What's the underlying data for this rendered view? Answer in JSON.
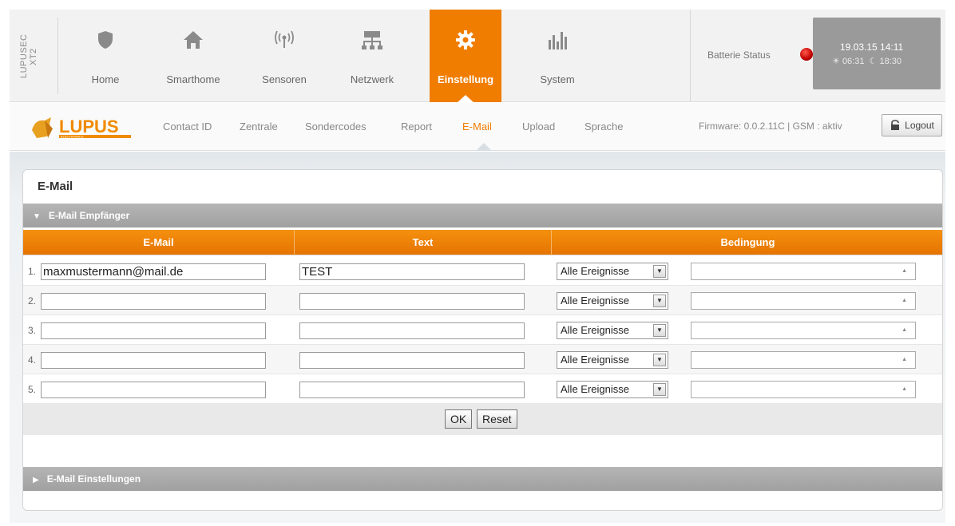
{
  "brand": {
    "line1": "LUPUSEC",
    "line2": "XT2"
  },
  "nav": [
    {
      "label": "Home",
      "icon": "shield-icon"
    },
    {
      "label": "Smarthome",
      "icon": "house-icon"
    },
    {
      "label": "Sensoren",
      "icon": "signal-icon"
    },
    {
      "label": "Netzwerk",
      "icon": "network-icon"
    },
    {
      "label": "Einstellung",
      "icon": "gear-icon",
      "active": true
    },
    {
      "label": "System",
      "icon": "bars-icon"
    }
  ],
  "status": {
    "battery_label": "Batterie Status",
    "battery_color": "#c00000",
    "datetime": "19.03.15 14:11",
    "sunrise": "06:31",
    "sunset": "18:30"
  },
  "subnav": {
    "logo_text": "LUPUS",
    "logo_sub": "ELECTRONICS",
    "items": [
      {
        "label": "Contact ID"
      },
      {
        "label": "Zentrale"
      },
      {
        "label": "Sondercodes"
      },
      {
        "label": "Report"
      },
      {
        "label": "E-Mail",
        "active": true
      },
      {
        "label": "Upload"
      },
      {
        "label": "Sprache"
      }
    ],
    "firmware": "Firmware: 0.0.2.11C | GSM : aktiv",
    "logout_label": "Logout"
  },
  "panel": {
    "title": "E-Mail",
    "section_recipients": "E-Mail Empfänger",
    "section_settings": "E-Mail Einstellungen",
    "columns": [
      "E-Mail",
      "Text",
      "Bedingung"
    ],
    "rows": [
      {
        "num": "1.",
        "email": "maxmustermann@mail.de",
        "text": "TEST",
        "condition": "Alle Ereignisse"
      },
      {
        "num": "2.",
        "email": "",
        "text": "",
        "condition": "Alle Ereignisse"
      },
      {
        "num": "3.",
        "email": "",
        "text": "",
        "condition": "Alle Ereignisse"
      },
      {
        "num": "4.",
        "email": "",
        "text": "",
        "condition": "Alle Ereignisse"
      },
      {
        "num": "5.",
        "email": "",
        "text": "",
        "condition": "Alle Ereignisse"
      }
    ],
    "ok_label": "OK",
    "reset_label": "Reset"
  },
  "colors": {
    "accent": "#f07d00",
    "section_bar": "#a8a8a8"
  }
}
